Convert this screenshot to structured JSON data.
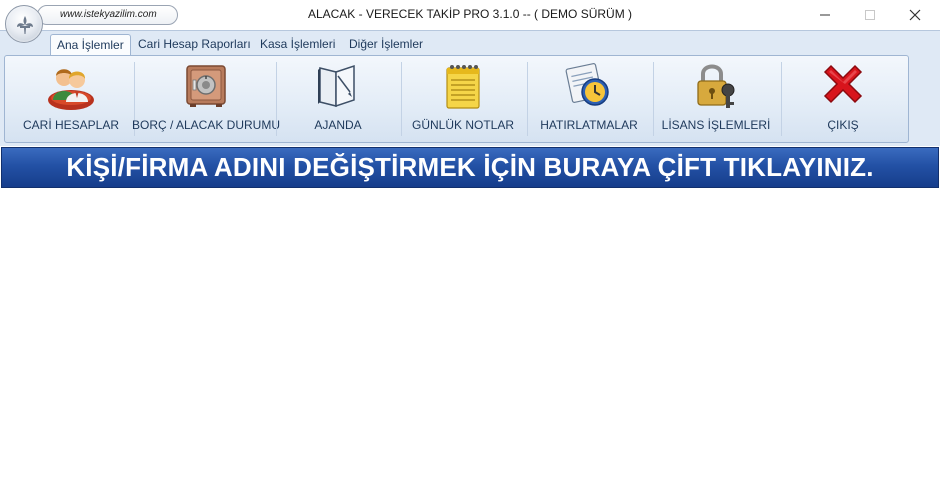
{
  "window": {
    "website": "www.istekyazilim.com",
    "title": "ALACAK - VERECEK TAKİP PRO 3.1.0 -- ( DEMO SÜRÜM )"
  },
  "tabs": [
    {
      "label": "Ana İşlemler",
      "active": true
    },
    {
      "label": "Cari Hesap Raporları",
      "active": false
    },
    {
      "label": "Kasa İşlemleri",
      "active": false
    },
    {
      "label": "Diğer İşlemler",
      "active": false
    }
  ],
  "ribbon_buttons": [
    {
      "label": "CARİ HESAPLAR",
      "icon": "users-icon"
    },
    {
      "label": "BORÇ / ALACAK DURUMU",
      "icon": "safe-icon"
    },
    {
      "label": "AJANDA",
      "icon": "notebook-icon"
    },
    {
      "label": "GÜNLÜK NOTLAR",
      "icon": "notepad-icon"
    },
    {
      "label": "HATIRLATMALAR",
      "icon": "reminder-clock-icon"
    },
    {
      "label": "LİSANS İŞLEMLERİ",
      "icon": "padlock-key-icon"
    },
    {
      "label": "ÇIKIŞ",
      "icon": "exit-x-icon"
    }
  ],
  "banner": {
    "text": "KİŞİ/FİRMA ADINI DEĞİŞTİRMEK İÇİN BURAYA ÇİFT TIKLAYINIZ."
  },
  "colors": {
    "ribbon_bg": "#dfe9f5",
    "banner_bg": "#2351a5",
    "exit_red": "#d8141c"
  }
}
